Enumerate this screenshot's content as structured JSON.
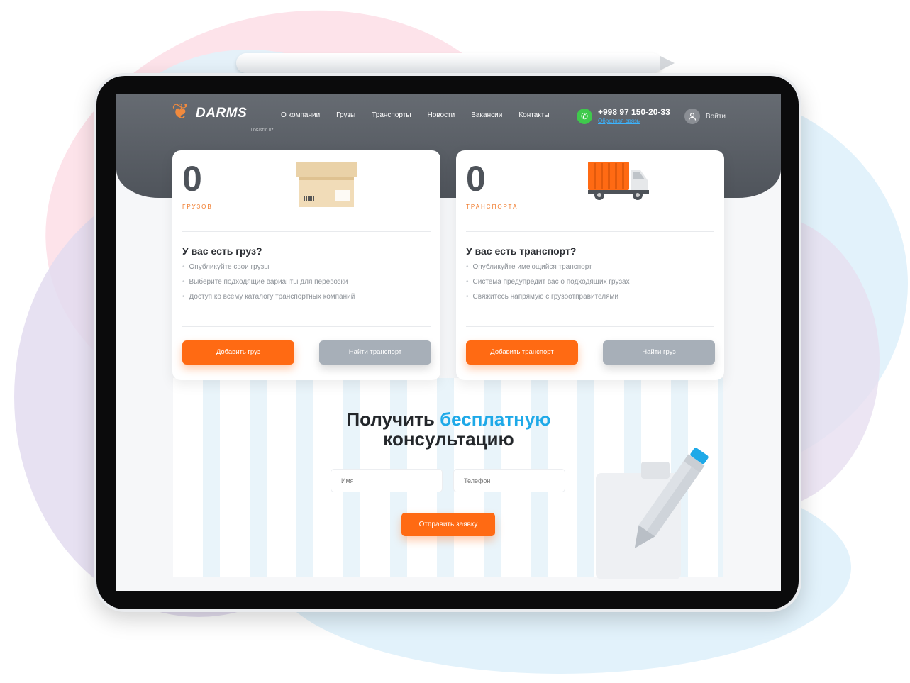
{
  "brand": {
    "name": "DARMS",
    "subtitle": "LOGISTIC.UZ",
    "color": "#f08a3e"
  },
  "nav": {
    "items": [
      "О компании",
      "Грузы",
      "Транспорты",
      "Новости",
      "Вакансии",
      "Контакты"
    ]
  },
  "contact": {
    "phone": "+998 97 150-20-33",
    "feedback_link": "Обратная связь",
    "phone_icon": "phone-icon"
  },
  "auth": {
    "login_label": "Войти",
    "icon": "user-icon"
  },
  "cards": [
    {
      "count": "0",
      "count_label": "ГРУЗОВ",
      "title": "У вас есть груз?",
      "bullets": [
        "Опубликуйте свои грузы",
        "Выберите подходящие варианты для перевозки",
        "Доступ ко всему каталогу транспортных компаний"
      ],
      "primary_button": "Добавить груз",
      "secondary_button": "Найти транспорт",
      "illustration": "cardboard-box-icon"
    },
    {
      "count": "0",
      "count_label": "ТРАНСПОРТА",
      "title": "У вас есть транспорт?",
      "bullets": [
        "Опубликуйте имеющийся транспорт",
        "Система предупредит вас о подходящих грузах",
        "Свяжитесь напрямую с грузоотправителями"
      ],
      "primary_button": "Добавить транспорт",
      "secondary_button": "Найти груз",
      "illustration": "truck-icon"
    }
  ],
  "consultation": {
    "title_part1": "Получить",
    "title_accent": "бесплатную",
    "title_part2": "консультацию",
    "name_placeholder": "Имя",
    "phone_placeholder": "Телефон",
    "submit_label": "Отправить заявку"
  },
  "colors": {
    "accent_orange": "#ff6a13",
    "accent_blue": "#1ea9e8",
    "button_gray": "#a7afb8",
    "header_gray": "#5a5f66"
  }
}
